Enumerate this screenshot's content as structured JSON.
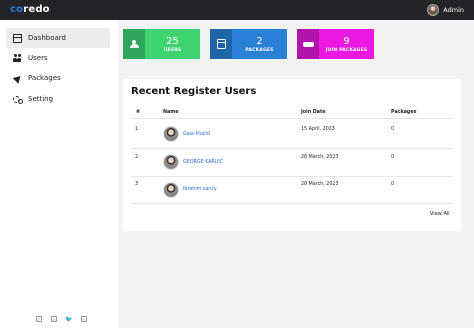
{
  "app": {
    "logo_prefix": "co",
    "logo_suffix": "redo",
    "user_label": "Admin",
    "accent_color": "#2a7be4"
  },
  "sidebar": {
    "items": [
      {
        "label": "Dashboard",
        "icon": "dashboard-icon",
        "active": true
      },
      {
        "label": "Users",
        "icon": "users-icon",
        "active": false
      },
      {
        "label": "Packages",
        "icon": "rocket-icon",
        "active": false
      },
      {
        "label": "Setting",
        "icon": "gear-icon",
        "active": false
      }
    ],
    "social_icons": [
      "facebook-icon",
      "instagram-icon",
      "twitter-icon",
      "linkedin-icon"
    ]
  },
  "stats": [
    {
      "value": "25",
      "label": "USERS",
      "icon": "users-icon",
      "color": "#3fd470"
    },
    {
      "value": "2",
      "label": "PACKAGES",
      "icon": "calendar-icon",
      "color": "#2a80d6"
    },
    {
      "value": "9",
      "label": "JOIN PACKAGES",
      "icon": "handshake-icon",
      "color": "#ee18e3"
    }
  ],
  "recent": {
    "title": "Recent Register Users",
    "columns": [
      "#",
      "Name",
      "Join Date",
      "Packages"
    ],
    "rows": [
      {
        "num": "1",
        "name": "Gaia khalid",
        "date": "15 April, 2023",
        "packages": "0"
      },
      {
        "num": "2",
        "name": "GEORGE KARUIC",
        "date": "28 March, 2023",
        "packages": "0"
      },
      {
        "num": "3",
        "name": "Ibrehim sanzy",
        "date": "20 March, 2023",
        "packages": "0"
      }
    ],
    "view_all": "View All"
  }
}
